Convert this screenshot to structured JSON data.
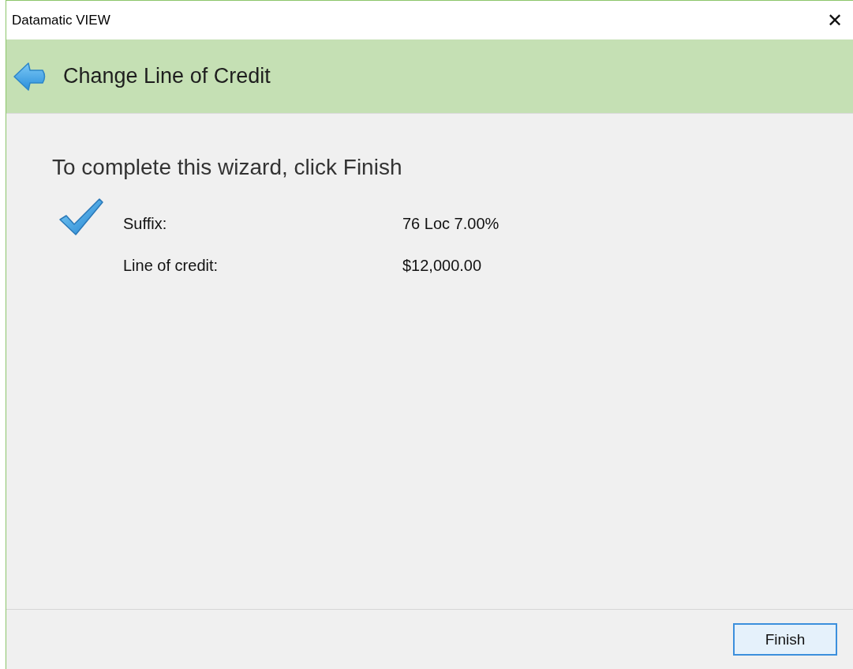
{
  "window": {
    "title": "Datamatic VIEW",
    "close": "✕"
  },
  "header": {
    "title": "Change Line of Credit"
  },
  "heading": "To complete this wizard, click Finish",
  "summary": [
    {
      "label": "Suffix:",
      "value": "76 Loc 7.00%"
    },
    {
      "label": "Line of credit:",
      "value": "$12,000.00"
    }
  ],
  "buttons": [
    {
      "label": "Finish",
      "focused": true
    }
  ]
}
